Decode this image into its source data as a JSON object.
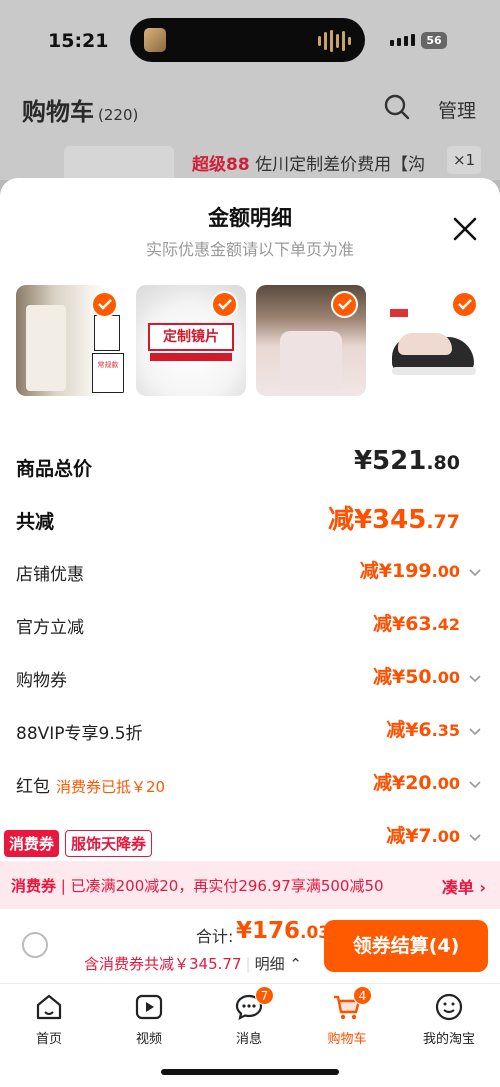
{
  "status_bar": {
    "time": "15:21",
    "battery": "56"
  },
  "header": {
    "title": "购物车",
    "count": "(220)",
    "manage_label": "管理"
  },
  "peek_item": {
    "badge": "超级88",
    "title": "佐川定制差价费用【沟",
    "qty": "×1"
  },
  "sheet": {
    "title": "金额明细",
    "subtitle": "实际优惠金额请以下单页为准",
    "thumbs": [
      {
        "name": "pants",
        "caption": "常规款"
      },
      {
        "name": "lens",
        "caption": "定制镜片"
      },
      {
        "name": "shirt",
        "caption": ""
      },
      {
        "name": "sneaker",
        "caption": ""
      }
    ],
    "rows": [
      {
        "label": "商品总价",
        "value": "¥521",
        "decimal": ".80",
        "note": ""
      },
      {
        "label": "共减",
        "value": "减¥345",
        "decimal": ".77",
        "note": ""
      },
      {
        "label": "店铺优惠",
        "value": "减¥199",
        "decimal": ".00",
        "note": ""
      },
      {
        "label": "官方立减",
        "value": "减¥63",
        "decimal": ".42",
        "note": ""
      },
      {
        "label": "购物券",
        "value": "减¥50",
        "decimal": ".00",
        "note": ""
      },
      {
        "label": "88VIP专享9.5折",
        "value": "减¥6",
        "decimal": ".35",
        "note": ""
      },
      {
        "label": "红包",
        "value": "减¥20",
        "decimal": ".00",
        "note": "消费券已抵￥20"
      },
      {
        "label": "",
        "value": "减¥7",
        "decimal": ".00",
        "note": ""
      }
    ],
    "tags": [
      "消费券",
      "服饰天降券"
    ]
  },
  "promo": {
    "label": "消费券",
    "text": "已凑满200减20，再实付296.97享满500减50",
    "action": "凑单 ›"
  },
  "checkout": {
    "total_label": "合计:",
    "total_value": "¥176",
    "total_decimal": ".03",
    "savings": "含消费券共减￥345.77",
    "detail": "明细 ⌃",
    "pay_button": "领券结算(4)"
  },
  "tabbar": [
    {
      "label": "首页",
      "icon": "home-icon",
      "badge": ""
    },
    {
      "label": "视频",
      "icon": "video-icon",
      "badge": ""
    },
    {
      "label": "消息",
      "icon": "message-icon",
      "badge": "7"
    },
    {
      "label": "购物车",
      "icon": "cart-icon",
      "badge": "4"
    },
    {
      "label": "我的淘宝",
      "icon": "profile-icon",
      "badge": ""
    }
  ],
  "colors": {
    "accent": "#ff5000",
    "promo_red": "#e8173e"
  }
}
